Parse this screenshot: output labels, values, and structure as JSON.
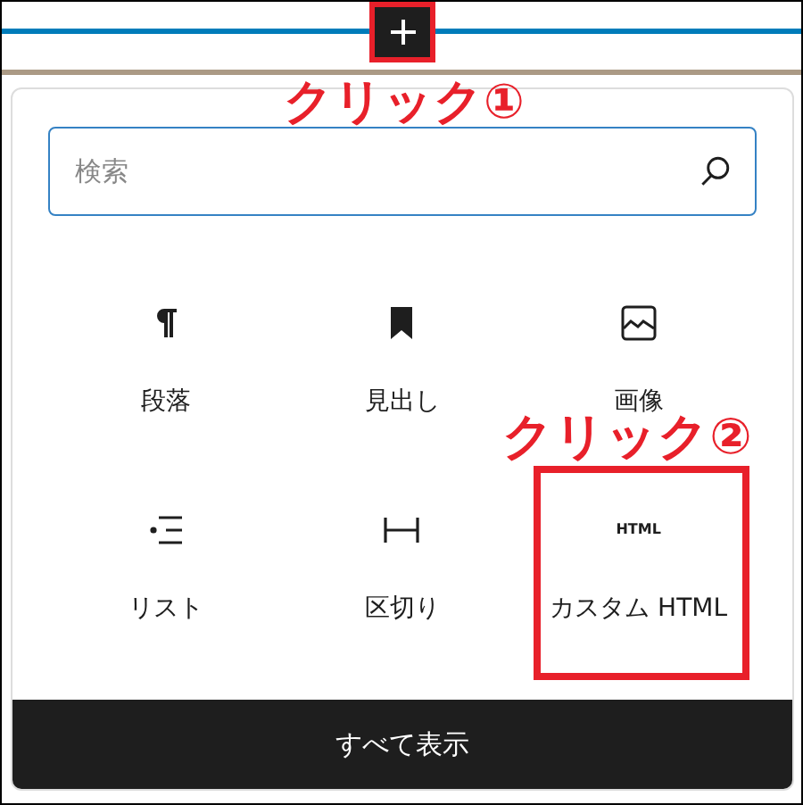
{
  "toolbar": {
    "add_button": {
      "highlighted": true
    }
  },
  "inserter": {
    "search": {
      "placeholder": "検索"
    },
    "blocks": [
      {
        "kind": "paragraph",
        "label": "段落",
        "highlighted": false
      },
      {
        "kind": "heading",
        "label": "見出し",
        "highlighted": false
      },
      {
        "kind": "image",
        "label": "画像",
        "highlighted": false
      },
      {
        "kind": "list",
        "label": "リスト",
        "highlighted": false
      },
      {
        "kind": "separator",
        "label": "区切り",
        "highlighted": false
      },
      {
        "kind": "html",
        "icon_text": "HTML",
        "label": "カスタム HTML",
        "highlighted": true
      }
    ],
    "browse_all": "すべて表示"
  },
  "annotations": [
    {
      "text": "クリック①"
    },
    {
      "text": "クリック②"
    }
  ]
}
